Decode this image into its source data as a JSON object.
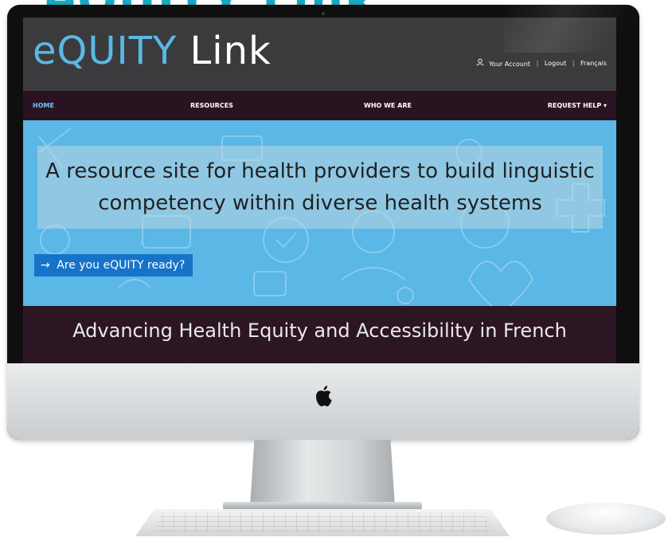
{
  "promo_title": "eQUITY Link",
  "site": {
    "logo": {
      "light": "eQUITY",
      "bold": "Link"
    },
    "header_links": {
      "account": "Your Account",
      "logout": "Logout",
      "language": "Français",
      "separator": "|"
    },
    "nav": {
      "home": "HOME",
      "resources": "RESOURCES",
      "who_we_are": "WHO WE ARE",
      "request_help": "REQUEST HELP ▾"
    },
    "hero": {
      "heading": "A resource site for health providers to build linguistic competency within diverse health systems",
      "cta": "Are you eQUITY ready?",
      "cta_arrow": "→"
    },
    "tagline": "Advancing Health Equity and Accessibility in French"
  },
  "colors": {
    "header_bg": "#3b3b3e",
    "nav_bg": "#2a1320",
    "nav_active": "#6cc7ff",
    "logo_accent": "#5bb8e4",
    "hero_bg": "#5ab7e6",
    "cta_bg": "#1773c9",
    "tagline_bg": "#2c1623",
    "promo_title": "#1aa9c2"
  }
}
